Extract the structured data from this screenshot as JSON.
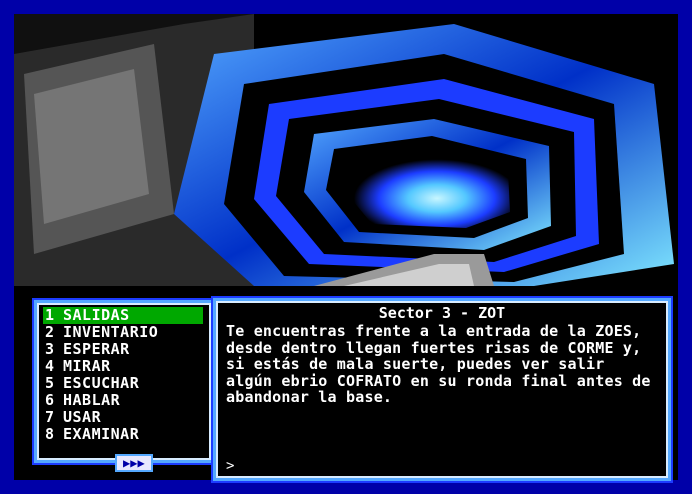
{
  "scene": {
    "icon": "tunnel-scene-image"
  },
  "menu": {
    "items": [
      {
        "num": "1",
        "label": "SALIDAS",
        "selected": true
      },
      {
        "num": "2",
        "label": "INVENTARIO",
        "selected": false
      },
      {
        "num": "3",
        "label": "ESPERAR",
        "selected": false
      },
      {
        "num": "4",
        "label": "MIRAR",
        "selected": false
      },
      {
        "num": "5",
        "label": "ESCUCHAR",
        "selected": false
      },
      {
        "num": "6",
        "label": "HABLAR",
        "selected": false
      },
      {
        "num": "7",
        "label": "USAR",
        "selected": false
      },
      {
        "num": "8",
        "label": "EXAMINAR",
        "selected": false
      }
    ],
    "more": "▶▶▶"
  },
  "location": {
    "title": "Sector 3 - ZOT",
    "description": "Te encuentras frente a la entrada de la ZOES, desde dentro llegan fuertes risas de CORME y, si estás de mala suerte, puedes ver salir algún ebrio COFRATO en su ronda final antes de abandonar la base."
  },
  "prompt": ">",
  "colors": {
    "border": "#0000a8",
    "frame": "#54a8ff",
    "selected": "#00a800"
  }
}
